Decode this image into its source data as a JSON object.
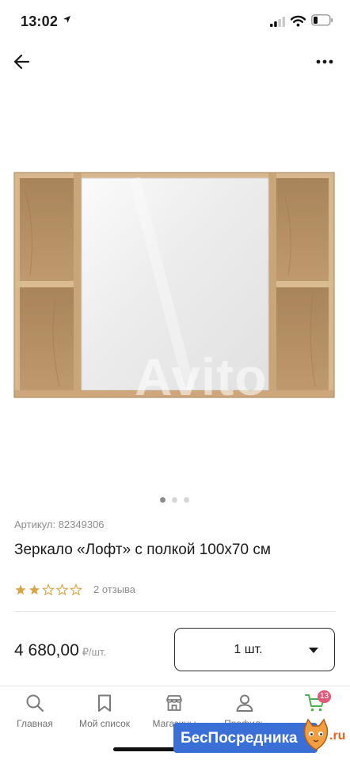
{
  "status_bar": {
    "time": "13:02"
  },
  "product": {
    "watermark": "Avito",
    "article": "Артикул: 82349306",
    "title": "Зеркало «Лофт» с полкой 100x70 см",
    "rating": 2,
    "rating_max": 5,
    "reviews": "2 отзыва",
    "image_pages": 3,
    "current_image": 1
  },
  "purchase": {
    "price": "4 680,00",
    "unit": "₽/шт.",
    "quantity": "1 шт."
  },
  "tab_bar": {
    "items": [
      {
        "label": "Главная",
        "icon": "search-icon"
      },
      {
        "label": "Мой список",
        "icon": "bookmark-icon"
      },
      {
        "label": "Магазины",
        "icon": "store-icon"
      },
      {
        "label": "Профиль",
        "icon": "profile-icon"
      },
      {
        "label": "",
        "icon": "cart-icon",
        "badge": "13"
      }
    ]
  },
  "overlay": {
    "text": "БесПосредника",
    "suffix": ".ru"
  },
  "colors": {
    "star": "#d9a441",
    "wood": "#c59f72",
    "badge": "#e05a7a",
    "overlay": "#3b6fd8"
  }
}
